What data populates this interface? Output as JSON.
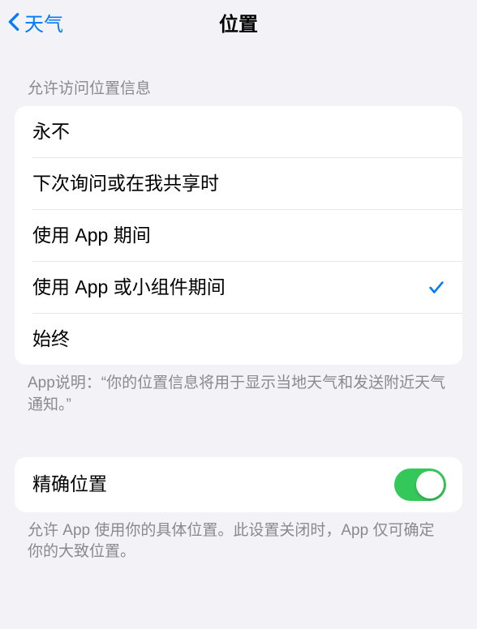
{
  "nav": {
    "back_label": "天气",
    "title": "位置"
  },
  "section1": {
    "header": "允许访问位置信息",
    "items": [
      {
        "label": "永不",
        "selected": false
      },
      {
        "label": "下次询问或在我共享时",
        "selected": false
      },
      {
        "label": "使用 App 期间",
        "selected": false
      },
      {
        "label": "使用 App 或小组件期间",
        "selected": true
      },
      {
        "label": "始终",
        "selected": false
      }
    ],
    "footer": "App说明：“你的位置信息将用于显示当地天气和发送附近天气通知。”"
  },
  "section2": {
    "precise_label": "精确位置",
    "precise_on": true,
    "footer": "允许 App 使用你的具体位置。此设置关闭时，App 仅可确定你的大致位置。"
  }
}
